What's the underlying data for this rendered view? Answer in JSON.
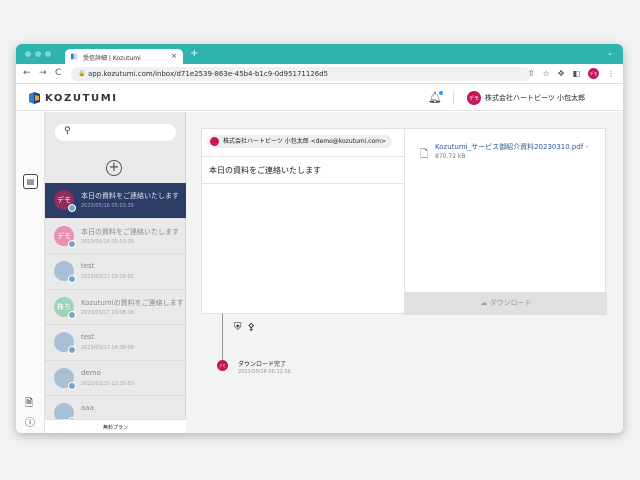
{
  "browser": {
    "tab_title": "受信詳細 | Kozutumi",
    "tab_close": "×",
    "new_tab": "+",
    "tab_menu": "⌄",
    "url": "app.kozutumi.com/inbox/d71e2539-863e-45b4-b1c9-0d95171126d5",
    "back": "←",
    "forward": "→",
    "reload": "C",
    "profile_initials": "デモ"
  },
  "app": {
    "brand": "KOZUTUMI",
    "user_initials": "デモ",
    "user_name": "株式会社ハートビーツ 小包太郎",
    "plan": "無料プラン"
  },
  "inbox": {
    "items": [
      {
        "title": "本日の資料をご連絡いたします",
        "date": "2023/05/16 05:03:39",
        "initials": "デモ",
        "color": "#8f2d5a",
        "selected": true
      },
      {
        "title": "本日の資料をご連絡いたします",
        "date": "2023/05/16 05:03:39",
        "initials": "デモ",
        "color": "#e98fb4",
        "selected": false
      },
      {
        "title": "test",
        "date": "2023/03/17 19:28:02",
        "initials": "",
        "color": "#a9bfd6",
        "selected": false
      },
      {
        "title": "Kozutumiの資料をご連絡します",
        "date": "2023/03/17 19:08:18",
        "initials": "株ち",
        "color": "#9fd3b8",
        "selected": false
      },
      {
        "title": "test",
        "date": "2023/03/17 14:38:09",
        "initials": "",
        "color": "#a9bfd6",
        "selected": false
      },
      {
        "title": "demo",
        "date": "2023/03/15 12:30:53",
        "initials": "",
        "color": "#a9bfd6",
        "selected": false
      },
      {
        "title": "aaa",
        "date": "",
        "initials": "",
        "color": "#a9bfd6",
        "selected": false
      }
    ]
  },
  "message": {
    "sender": "株式会社ハートビーツ 小包太郎 <demo@kozutumi.com>",
    "subject": "本日の資料をご連絡いたします",
    "file_name": "Kozutumi_サービス御紹介資料20230310.pdf -",
    "file_size": "870.72 kB",
    "download_label": "ダウンロード"
  },
  "timeline": {
    "event_label": "ダウンロード完了",
    "event_date": "2023/05/18 06:12:56",
    "initials": "デモ"
  },
  "colors": {
    "titlebar": "#2fb3ad",
    "selected_item": "#2b3d66",
    "accent": "#c2185b"
  }
}
